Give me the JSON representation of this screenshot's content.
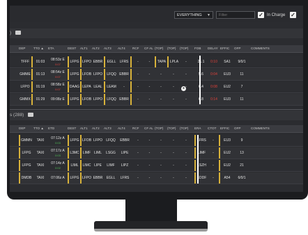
{
  "toolbar": {
    "view_select": "EVERYTHING",
    "filter_placeholder": "Filter",
    "in_charge_label": "In Charge"
  },
  "section1": {
    "count_label": ")",
    "columns": [
      "DEP",
      "TTO ▲",
      "ETA",
      "DEST",
      "ALT1",
      "ALT2",
      "ALT3",
      "ALT4",
      "RCF",
      "CF AL",
      "(TOP)",
      "(TOP)",
      "(TOP)",
      "FOB",
      "DELAY",
      "EFFIC",
      "OFP",
      "COMMENTS"
    ],
    "rows": [
      {
        "dep": "TFFF",
        "tto": "01:03",
        "eta": "08:53z E",
        "eta_sub": "0:07",
        "dest": "LFPG",
        "alt1": "LFPO",
        "alt2": "EBBR",
        "alt3": "EGLL",
        "alt4": "LFRS",
        "rcf": "-",
        "cfal": "-",
        "top1": "TAPA",
        "top2": "LPLA",
        "top3": "-",
        "fob": "21.1",
        "delay": "0:10",
        "effic": "SA1",
        "ofp": "9/0/1",
        "comments": ""
      },
      {
        "dep": "GMME",
        "tto": "01:13",
        "eta": "08:54z E",
        "eta_sub": "0:07",
        "dest": "LFPG",
        "alt1": "LFOB",
        "alt2": "LFPO",
        "alt3": "LFQQ",
        "alt4": "EBBR",
        "rcf": "-",
        "cfal": "-",
        "top1": "-",
        "top2": "-",
        "top3": "-",
        "fob": "5.6",
        "delay": "0:04",
        "effic": "EU3",
        "ofp": "11",
        "comments": ""
      },
      {
        "dep": "LFPO",
        "tto": "01:19",
        "eta": "08:58z E",
        "eta_sub": "0:07",
        "dest": "DAAG",
        "alt1": "LEPA",
        "alt2": "LEAL",
        "alt3": "LEAM",
        "alt4": "-",
        "rcf": "-",
        "cfal": "-",
        "top1": "-",
        "top2": "-",
        "top3": "-",
        "fob": "6.4",
        "delay": "0:08",
        "effic": "EU2",
        "ofp": "7",
        "comments": ""
      },
      {
        "dep": "GMMX",
        "tto": "01:29",
        "eta": "09:08z E",
        "eta_sub": "",
        "dest": "LFPG",
        "alt1": "LFOB",
        "alt2": "LFPO",
        "alt3": "LFQQ",
        "alt4": "EBBR",
        "rcf": "-",
        "cfal": "-",
        "top1": "-",
        "top2": "-",
        "top3": "-",
        "fob": "6.8",
        "delay": "0:14",
        "effic": "EU3",
        "ofp": "11",
        "comments": ""
      }
    ]
  },
  "section2": {
    "count_label": "s (288)",
    "columns": [
      "DEP",
      "TTO ▲",
      "ETD",
      "DEST",
      "ALT1",
      "ALT2",
      "ALT3",
      "ALT4",
      "RCF",
      "CF AL",
      "(TOP)",
      "(TOP)",
      "(TOP)",
      "ERA",
      "CTOT",
      "EFFIC",
      "OFP",
      "COMMENTS"
    ],
    "rows": [
      {
        "dep": "GMMN",
        "tto": "TAXI",
        "etd": "07:12z A",
        "etd_sub": "0:03",
        "dest": "LFPG",
        "alt1": "LFOB",
        "alt2": "LFPO",
        "alt3": "LFQQ",
        "alt4": "EBBR",
        "era": "LFRS",
        "ctot": "-",
        "effic": "EU3",
        "ofp": "9"
      },
      {
        "dep": "LFPG",
        "tto": "TAXI",
        "etd": "07:17z A",
        "etd_sub": "0:03",
        "dest": "L3MC",
        "alt1": "LIMF",
        "alt2": "LIML",
        "alt3": "LSGG",
        "alt4": "LIPE",
        "era": "LIMF",
        "ctot": "-",
        "effic": "EU2",
        "ofp": "13"
      },
      {
        "dep": "LFPG",
        "tto": "TAXI",
        "etd": "07:14z A",
        "etd_sub": "0:02",
        "dest": "LIML",
        "alt1": "LIMC",
        "alt2": "LIPE",
        "alt3": "LIMF",
        "alt4": "LIPZ",
        "era": "LSZH",
        "ctot": "-",
        "effic": "EU2",
        "ofp": "21"
      },
      {
        "dep": "DMDB",
        "tto": "TAXI",
        "etd": "07:06z A",
        "etd_sub": "",
        "dest": "LFPG",
        "alt1": "LFPO",
        "alt2": "EBBR",
        "alt3": "EGLL",
        "alt4": "LFRS",
        "era": "EDDF",
        "ctot": "-",
        "effic": "A54",
        "ofp": "6/0/1"
      }
    ]
  },
  "colors": {
    "warn": "#d8b23a",
    "late": "#e0413a",
    "ontime": "#4fbf55"
  }
}
